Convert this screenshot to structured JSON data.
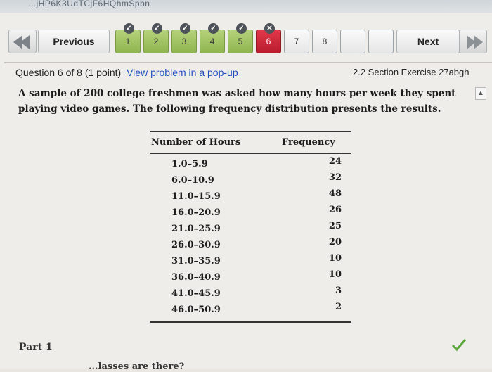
{
  "browser": {
    "url_fragment": "...jHP6K3UdTCjF6HQhmSpbn"
  },
  "nav": {
    "previous_label": "Previous",
    "next_label": "Next",
    "questions": [
      {
        "label": "1",
        "state": "done"
      },
      {
        "label": "2",
        "state": "done"
      },
      {
        "label": "3",
        "state": "done"
      },
      {
        "label": "4",
        "state": "done"
      },
      {
        "label": "5",
        "state": "done"
      },
      {
        "label": "6",
        "state": "current"
      },
      {
        "label": "7",
        "state": "todo"
      },
      {
        "label": "8",
        "state": "todo"
      },
      {
        "label": "",
        "state": "empty"
      },
      {
        "label": "",
        "state": "empty"
      }
    ]
  },
  "question": {
    "title": "Question 6 of 8 (1 point)",
    "popup_link": "View problem in a pop-up",
    "exercise": "2.2 Section Exercise 27abgh",
    "stem": "A sample of 200 college freshmen was asked how many hours per week they spent playing video games. The following frequency distribution presents the results."
  },
  "table": {
    "headers": [
      "Number of Hours",
      "Frequency"
    ],
    "rows": [
      {
        "hours": "1.0–5.9",
        "freq": "24"
      },
      {
        "hours": "6.0–10.9",
        "freq": "32"
      },
      {
        "hours": "11.0–15.9",
        "freq": "48"
      },
      {
        "hours": "16.0–20.9",
        "freq": "26"
      },
      {
        "hours": "21.0–25.9",
        "freq": "25"
      },
      {
        "hours": "26.0–30.9",
        "freq": "20"
      },
      {
        "hours": "31.0–35.9",
        "freq": "10"
      },
      {
        "hours": "36.0–40.9",
        "freq": "10"
      },
      {
        "hours": "41.0–45.9",
        "freq": "3"
      },
      {
        "hours": "46.0–50.9",
        "freq": "2"
      }
    ]
  },
  "part_label": "Part 1",
  "partial_text": "...lasses are there?",
  "colors": {
    "done": "#9bbf5a",
    "current": "#c8263a",
    "link": "#1f4fbf",
    "check": "#5aa83a"
  }
}
